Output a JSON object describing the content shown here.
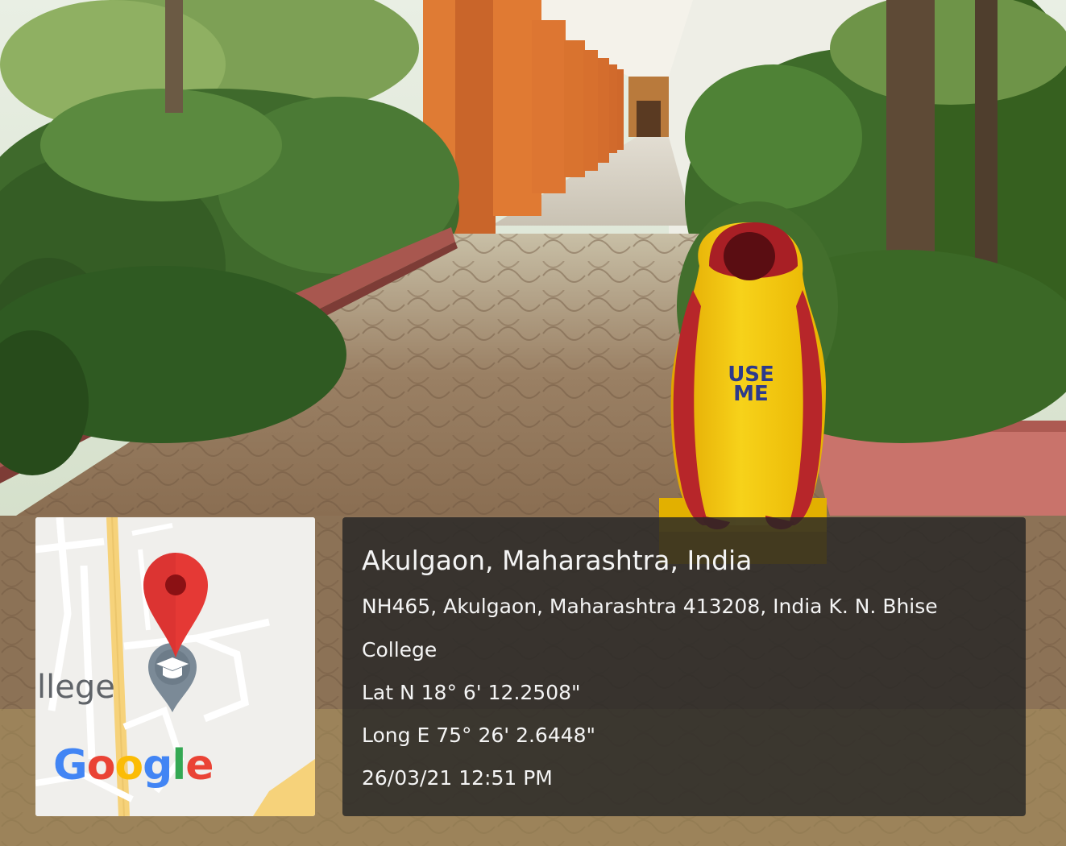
{
  "location": {
    "title": "Akulgaon, Maharashtra, India",
    "address_line1": "NH465, Akulgaon, Maharashtra 413208, India K. N. Bhise",
    "address_line2": "College",
    "latitude": "Lat N 18° 6' 12.2508\"",
    "longitude": "Long E 75° 26' 2.6448\"",
    "timestamp": "26/03/21 12:51 PM"
  },
  "map": {
    "place_label": "llege",
    "logo_letters": [
      "G",
      "o",
      "o",
      "g",
      "l",
      "e"
    ],
    "logo_colors": [
      "#4285F4",
      "#EA4335",
      "#FBBC05",
      "#4285F4",
      "#34A853",
      "#EA4335"
    ],
    "pin_color": "#E53935",
    "poi_icon": "graduation-cap-icon"
  },
  "photo": {
    "bin_text_line1": "USE",
    "bin_text_line2": "ME"
  }
}
